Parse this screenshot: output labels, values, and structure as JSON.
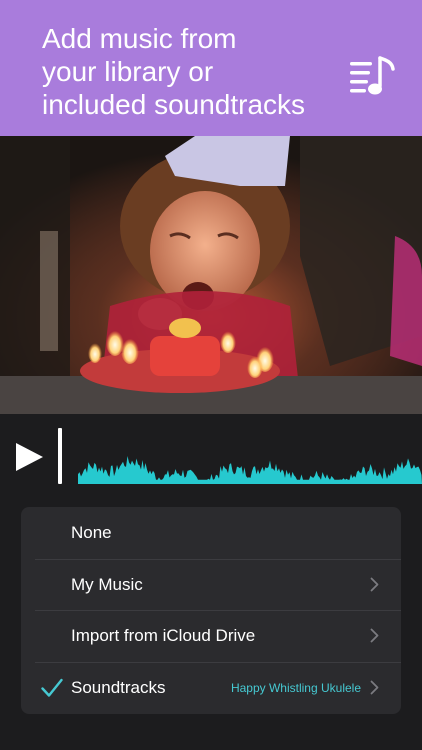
{
  "banner": {
    "title": "Add music from\nyour library or\nincluded soundtracks",
    "icon": "music-list-icon",
    "background": "#a97cdc"
  },
  "photo": {
    "icon": "photo-birthday-girl"
  },
  "player": {
    "play_icon": "play-icon",
    "waveform_color": "#26c9cf"
  },
  "menu": {
    "items": [
      {
        "label": "None",
        "chevron": false,
        "selected": false,
        "detail": ""
      },
      {
        "label": "My Music",
        "chevron": true,
        "selected": false,
        "detail": ""
      },
      {
        "label": "Import from iCloud Drive",
        "chevron": true,
        "selected": false,
        "detail": ""
      },
      {
        "label": "Soundtracks",
        "chevron": true,
        "selected": true,
        "detail": "Happy Whistling Ukulele"
      }
    ],
    "accent": "#46c9d2"
  }
}
